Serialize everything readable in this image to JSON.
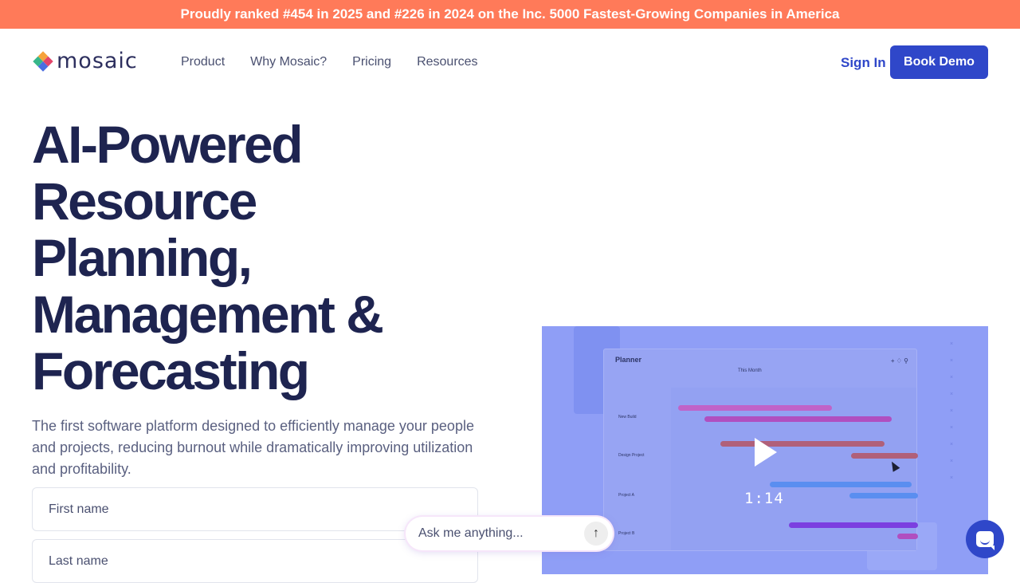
{
  "banner": {
    "text": "Proudly ranked #454 in 2025 and #226 in 2024 on the Inc. 5000 Fastest-Growing Companies in America"
  },
  "header": {
    "logo_text": "mosaic",
    "nav": [
      {
        "label": "Product"
      },
      {
        "label": "Why Mosaic?"
      },
      {
        "label": "Pricing"
      },
      {
        "label": "Resources"
      }
    ],
    "sign_in": "Sign In",
    "book_demo": "Book Demo"
  },
  "hero": {
    "title_lines": [
      "AI-Powered",
      "Resource",
      "Planning,",
      "Management &",
      "Forecasting"
    ],
    "subtitle": "The first software platform designed to efficiently manage your people and projects, reducing burnout while dramatically improving utilization and profitability."
  },
  "form": {
    "first_name_placeholder": "First name",
    "last_name_placeholder": "Last name"
  },
  "video": {
    "duration": "1:14",
    "planner_title": "Planner",
    "month_label": "This Month",
    "rows": [
      "New Build",
      "Design Project",
      "Project A",
      "Project B"
    ]
  },
  "ask": {
    "placeholder": "Ask me anything..."
  },
  "colors": {
    "banner": "#ff7a59",
    "primary": "#2f47c9",
    "heading": "#1e2450",
    "video_bg": "#8f9ef6"
  },
  "icons": {
    "send": "arrow-up-icon",
    "chat": "chat-bubble-icon",
    "play": "play-icon"
  }
}
